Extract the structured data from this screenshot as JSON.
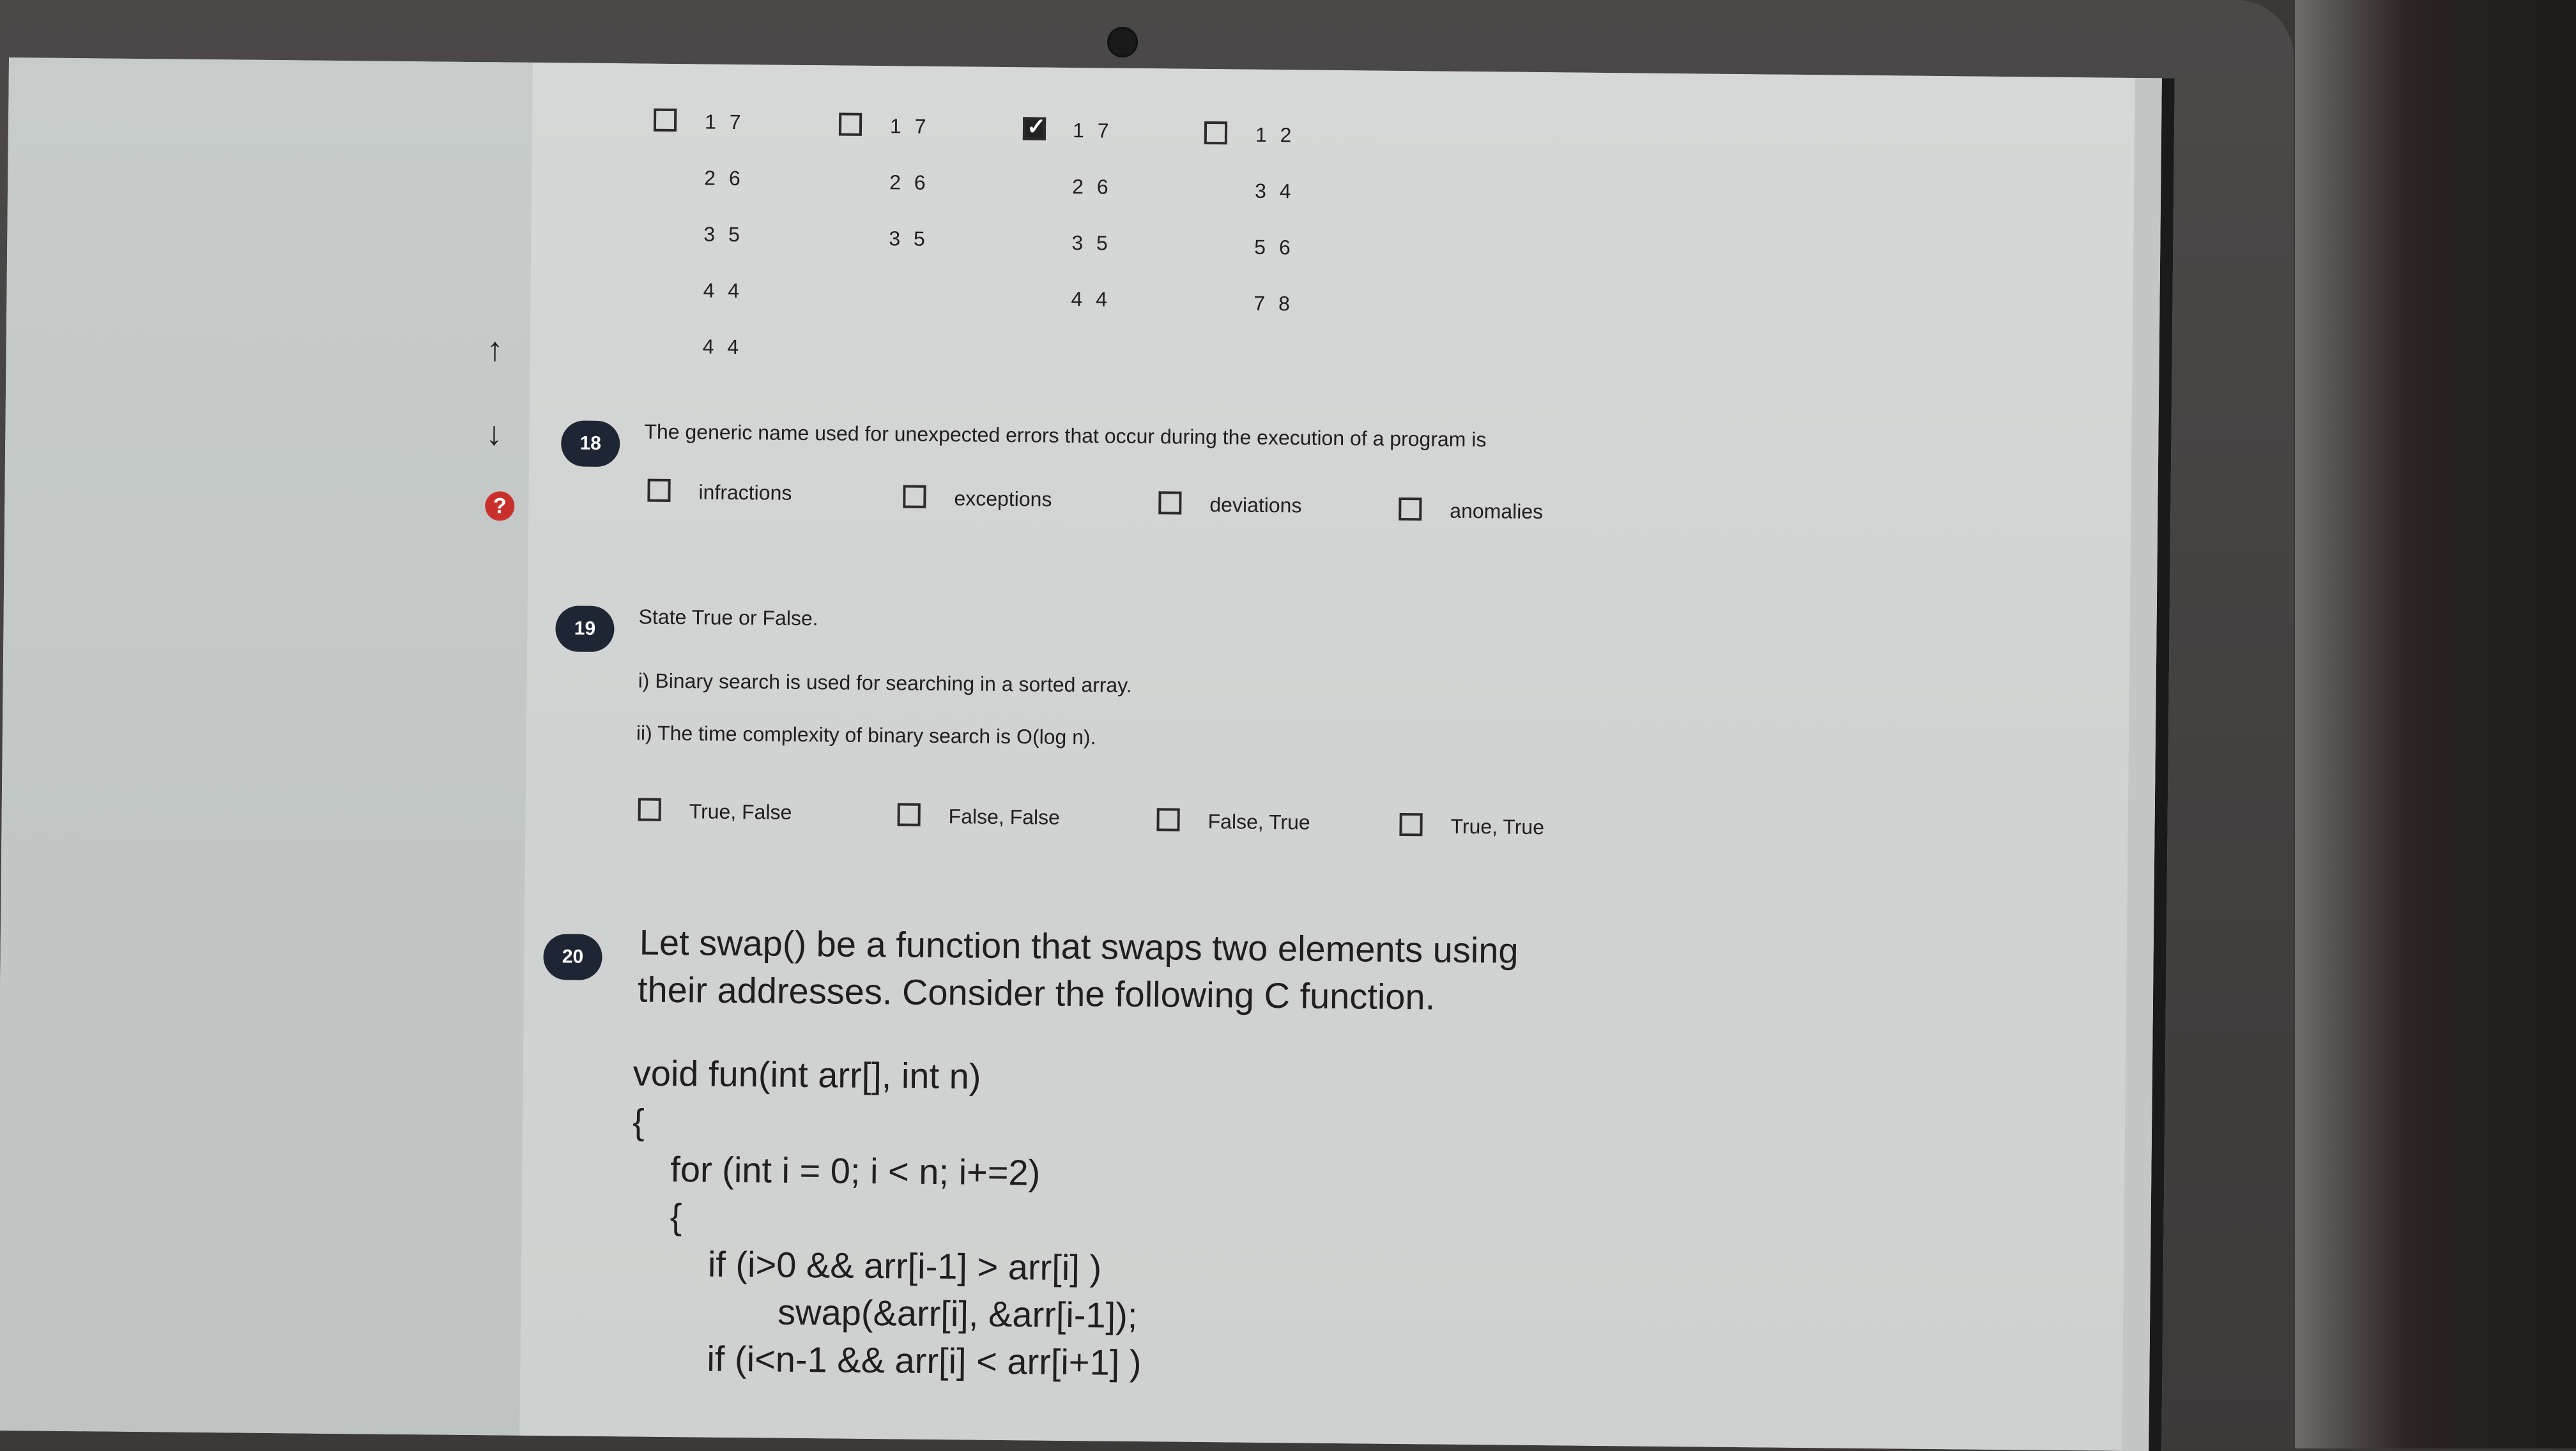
{
  "q17": {
    "columns": [
      {
        "checked": false,
        "values": [
          "1 7",
          "2 6",
          "3 5",
          "4 4",
          "4 4"
        ]
      },
      {
        "checked": false,
        "values": [
          "1 7",
          "2 6",
          "3 5"
        ]
      },
      {
        "checked": true,
        "values": [
          "1 7",
          "2 6",
          "3 5",
          "4 4"
        ]
      },
      {
        "checked": false,
        "values": [
          "1 2",
          "3 4",
          "5 6",
          "7 8"
        ]
      }
    ]
  },
  "nav": {
    "up_icon": "↑",
    "down_icon": "↓",
    "help_icon": "?"
  },
  "q18": {
    "number": "18",
    "text": "The generic name used for unexpected errors that occur during the execution of a program is",
    "options": [
      "infractions",
      "exceptions",
      "deviations",
      "anomalies"
    ]
  },
  "q19": {
    "number": "19",
    "text": "State True or False.",
    "statements": [
      "i) Binary search is used for searching in a sorted array.",
      "ii) The time complexity of binary search is O(log n)."
    ],
    "options": [
      "True, False",
      "False, False",
      "False, True",
      "True, True"
    ]
  },
  "q20": {
    "number": "20",
    "line1": "Let swap() be a function that swaps two elements using",
    "line2": "their addresses. Consider the following C function.",
    "code": [
      "void fun(int arr[], int n)",
      "{",
      "for (int i = 0; i < n; i+=2)",
      "{",
      "if (i>0 && arr[i-1] > arr[i] )",
      "swap(&arr[i], &arr[i-1]);",
      "if (i<n-1 && arr[i] < arr[i+1] )"
    ]
  }
}
